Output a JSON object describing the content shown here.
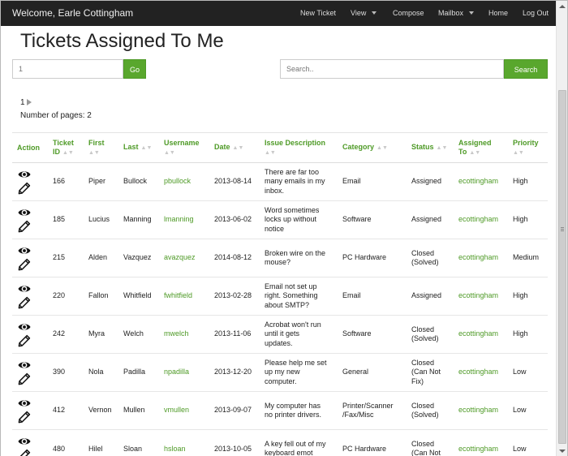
{
  "navbar": {
    "brand": "Welcome, Earle Cottingham",
    "items": [
      {
        "label": "New Ticket",
        "caret": false
      },
      {
        "label": "View",
        "caret": true
      },
      {
        "label": "Compose",
        "caret": false
      },
      {
        "label": "Mailbox",
        "caret": true
      },
      {
        "label": "Home",
        "caret": false
      },
      {
        "label": "Log Out",
        "caret": false
      }
    ]
  },
  "page": {
    "title": "Tickets Assigned To Me",
    "page_input_placeholder": "1",
    "go_label": "Go",
    "search_placeholder": "Search..",
    "search_label": "Search",
    "current_page": "1",
    "pages_text": "Number of pages: 2"
  },
  "table": {
    "headers": {
      "action": "Action",
      "ticket_id_1": "Ticket",
      "ticket_id_2": "ID",
      "first": "First",
      "last": "Last",
      "username": "Username",
      "date": "Date",
      "issue": "Issue Description",
      "category": "Category",
      "status": "Status",
      "assigned_1": "Assigned",
      "assigned_2": "To",
      "priority": "Priority"
    },
    "rows": [
      {
        "id": "166",
        "first": "Piper",
        "last": "Bullock",
        "username": "pbullock",
        "date": "2013-08-14",
        "issue": [
          "There are far too",
          "many emails in my",
          "inbox."
        ],
        "category": [
          "Email"
        ],
        "status": [
          "Assigned"
        ],
        "assigned": "ecottingham",
        "priority": "High"
      },
      {
        "id": "185",
        "first": "Lucius",
        "last": "Manning",
        "username": "lmanning",
        "date": "2013-06-02",
        "issue": [
          "Word sometimes",
          "locks up without",
          "notice"
        ],
        "category": [
          "Software"
        ],
        "status": [
          "Assigned"
        ],
        "assigned": "ecottingham",
        "priority": "High"
      },
      {
        "id": "215",
        "first": "Alden",
        "last": "Vazquez",
        "username": "avazquez",
        "date": "2014-08-12",
        "issue": [
          "Broken wire on the",
          "mouse?"
        ],
        "category": [
          "PC Hardware"
        ],
        "status": [
          "Closed",
          "(Solved)"
        ],
        "assigned": "ecottingham",
        "priority": "Medium"
      },
      {
        "id": "220",
        "first": "Fallon",
        "last": "Whitfield",
        "username": "fwhitfield",
        "date": "2013-02-28",
        "issue": [
          "Email not set up",
          "right. Something",
          "about SMTP?"
        ],
        "category": [
          "Email"
        ],
        "status": [
          "Assigned"
        ],
        "assigned": "ecottingham",
        "priority": "High"
      },
      {
        "id": "242",
        "first": "Myra",
        "last": "Welch",
        "username": "mwelch",
        "date": "2013-11-06",
        "issue": [
          "Acrobat won't run",
          "until it gets",
          "updates."
        ],
        "category": [
          "Software"
        ],
        "status": [
          "Closed",
          "(Solved)"
        ],
        "assigned": "ecottingham",
        "priority": "High"
      },
      {
        "id": "390",
        "first": "Nola",
        "last": "Padilla",
        "username": "npadilla",
        "date": "2013-12-20",
        "issue": [
          "Please help me set",
          "up my new",
          "computer."
        ],
        "category": [
          "General"
        ],
        "status": [
          "Closed",
          "(Can Not",
          "Fix)"
        ],
        "assigned": "ecottingham",
        "priority": "Low"
      },
      {
        "id": "412",
        "first": "Vernon",
        "last": "Mullen",
        "username": "vmullen",
        "date": "2013-09-07",
        "issue": [
          "My computer has",
          "no printer drivers."
        ],
        "category": [
          "Printer/Scanner",
          "/Fax/Misc"
        ],
        "status": [
          "Closed",
          "(Solved)"
        ],
        "assigned": "ecottingham",
        "priority": "Low"
      },
      {
        "id": "480",
        "first": "Hilel",
        "last": "Sloan",
        "username": "hsloan",
        "date": "2013-10-05",
        "issue": [
          "A key fell out of my",
          "keyboard emot"
        ],
        "category": [
          "PC Hardware"
        ],
        "status": [
          "Closed",
          "(Can Not"
        ],
        "assigned": "ecottingham",
        "priority": "Low"
      }
    ]
  },
  "icons": {
    "view": "eye-icon",
    "edit": "pencil-icon",
    "sort": "sort-icon",
    "accent": "#59a72d",
    "link": "#4e9a26"
  }
}
